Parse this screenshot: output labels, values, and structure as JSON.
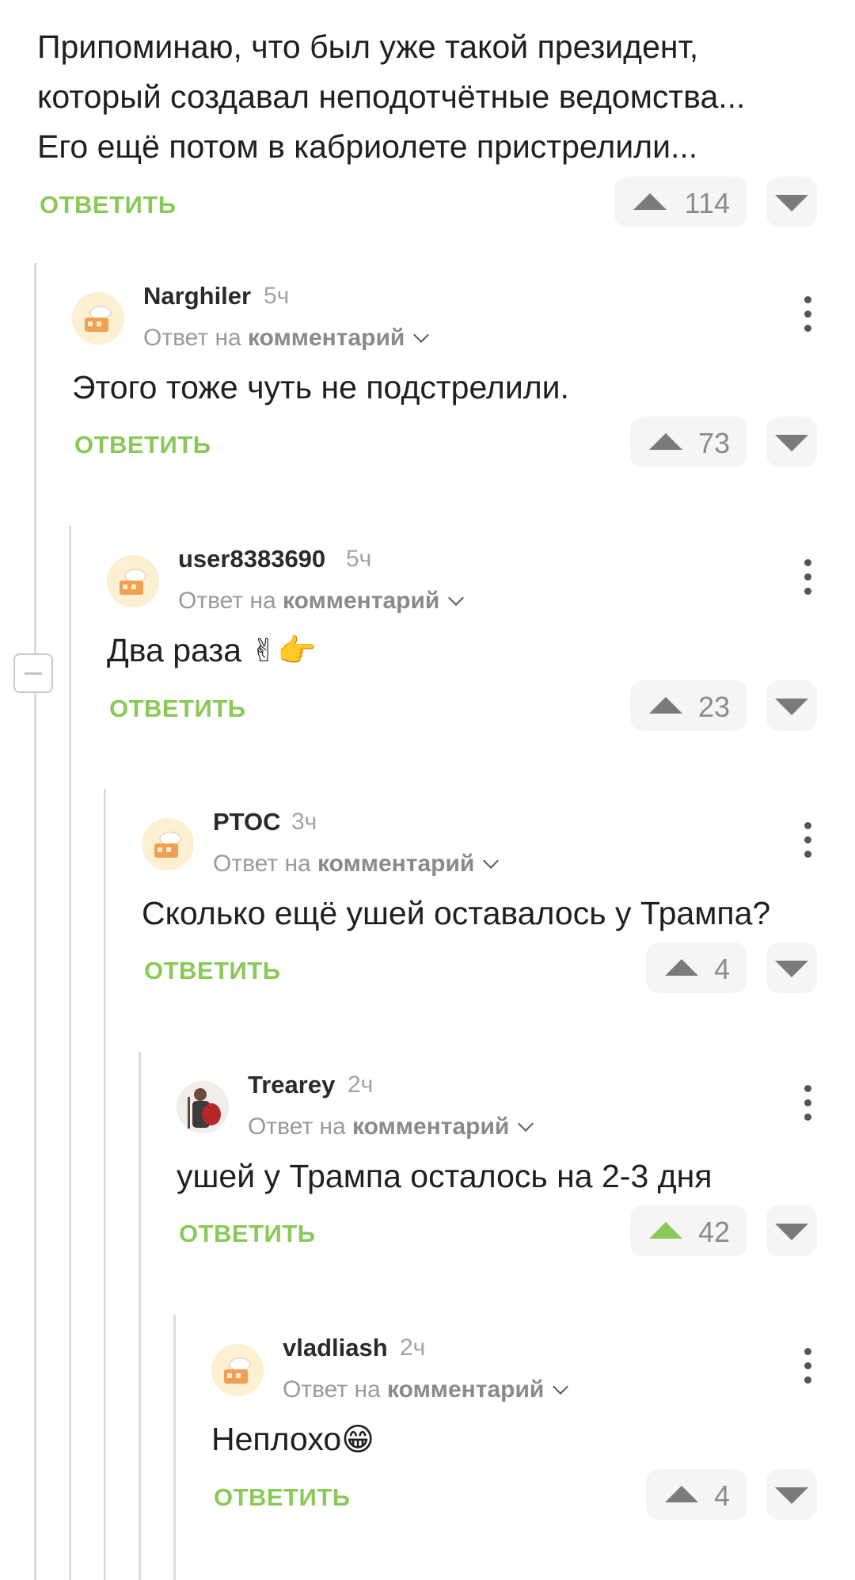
{
  "root": {
    "lines": [
      "Припоминаю, что был уже такой президент,",
      "который создавал неподотчётные ведомства...",
      "Его ещё потом в кабриолете пристрелили..."
    ],
    "reply_label": "ОТВЕТИТЬ",
    "votes": "114"
  },
  "reply_prefix": "Ответ на",
  "reply_target": "комментарий",
  "comments": [
    {
      "username": "Narghiler",
      "time": "5ч",
      "text": "Этого тоже чуть не подстрелили.",
      "reply_label": "ОТВЕТИТЬ",
      "votes": "73",
      "avatar_icon": "chef-avatar-icon"
    },
    {
      "username": "user8383690",
      "time": "5ч",
      "text": "Два раза",
      "emoji": "✌👉",
      "reply_label": "ОТВЕТИТЬ",
      "votes": "23",
      "avatar_icon": "chef-avatar-icon"
    },
    {
      "username": "PTOC",
      "time": "3ч",
      "text": "Сколько ещё ушей оставалось у Трампа?",
      "reply_label": "ОТВЕТИТЬ",
      "votes": "4",
      "avatar_icon": "chef-avatar-icon"
    },
    {
      "username": "Trearey",
      "time": "2ч",
      "text": "ушей у Трампа осталось на 2-3 дня",
      "reply_label": "ОТВЕТИТЬ",
      "votes": "42",
      "upvoted": true,
      "avatar_icon": "warrior-avatar-icon"
    },
    {
      "username": "vladliash",
      "time": "2ч",
      "text": "Неплохо",
      "emoji": "😁",
      "reply_label": "ОТВЕТИТЬ",
      "votes": "4",
      "avatar_icon": "chef-avatar-icon"
    }
  ],
  "colors": {
    "accent_green": "#8ac858",
    "thread_line": "#dcdcdc",
    "button_bg": "#f5f5f5"
  }
}
